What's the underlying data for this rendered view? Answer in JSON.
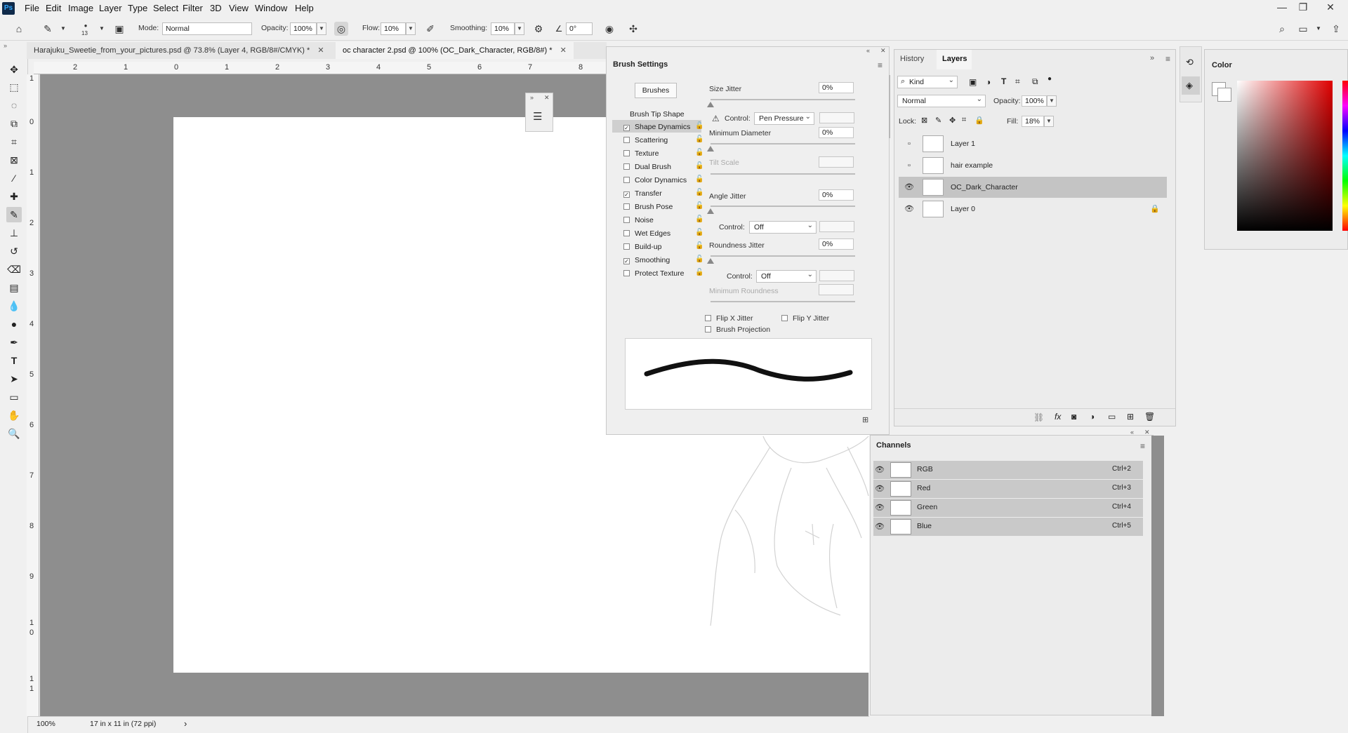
{
  "menu": {
    "logo": "Ps",
    "items": [
      "File",
      "Edit",
      "Image",
      "Layer",
      "Type",
      "Select",
      "Filter",
      "3D",
      "View",
      "Window",
      "Help"
    ]
  },
  "options": {
    "brush_size": "13",
    "mode_label": "Mode:",
    "mode_value": "Normal",
    "opacity_label": "Opacity:",
    "opacity_value": "100%",
    "flow_label": "Flow:",
    "flow_value": "10%",
    "smoothing_label": "Smoothing:",
    "smoothing_value": "10%",
    "angle_value": "0°"
  },
  "tabs": [
    {
      "label": "Harajuku_Sweetie_from_your_pictures.psd @ 73.8% (Layer 4, RGB/8#/CMYK) *"
    },
    {
      "label": "oc character 2.psd @ 100% (OC_Dark_Character, RGB/8#) *"
    }
  ],
  "ruler": {
    "top": [
      "2",
      "1",
      "0",
      "1",
      "2",
      "3",
      "4",
      "5",
      "6",
      "7",
      "8"
    ],
    "left": [
      "1",
      "0",
      "1",
      "2",
      "3",
      "4",
      "5",
      "6",
      "7",
      "8",
      "9",
      "1",
      "0",
      "1",
      "1"
    ]
  },
  "status": {
    "zoom": "100%",
    "doc_size": "17 in x 11 in (72 ppi)",
    "arrow": "›"
  },
  "brush_settings": {
    "title": "Brush Settings",
    "brushes_button": "Brushes",
    "tip_shape": "Brush Tip Shape",
    "items": [
      {
        "label": "Shape Dynamics",
        "checked": true
      },
      {
        "label": "Scattering",
        "checked": false
      },
      {
        "label": "Texture",
        "checked": false
      },
      {
        "label": "Dual Brush",
        "checked": false
      },
      {
        "label": "Color Dynamics",
        "checked": false
      },
      {
        "label": "Transfer",
        "checked": true
      },
      {
        "label": "Brush Pose",
        "checked": false
      },
      {
        "label": "Noise",
        "checked": false
      },
      {
        "label": "Wet Edges",
        "checked": false
      },
      {
        "label": "Build-up",
        "checked": false
      },
      {
        "label": "Smoothing",
        "checked": true
      },
      {
        "label": "Protect Texture",
        "checked": false
      }
    ],
    "size_jitter": "Size Jitter",
    "size_jitter_value": "0%",
    "control": "Control:",
    "pen_pressure": "Pen Pressure",
    "min_diameter": "Minimum Diameter",
    "min_diameter_value": "0%",
    "tilt_scale": "Tilt Scale",
    "angle_jitter": "Angle Jitter",
    "angle_jitter_value": "0%",
    "off1": "Off",
    "roundness_jitter": "Roundness Jitter",
    "roundness_jitter_value": "0%",
    "off2": "Off",
    "min_roundness": "Minimum Roundness",
    "flip_x": "Flip X Jitter",
    "flip_y": "Flip Y Jitter",
    "projection": "Brush Projection"
  },
  "layers": {
    "tab_history": "History",
    "tab_layers": "Layers",
    "kind": "Kind",
    "blend": "Normal",
    "opacity_label": "Opacity:",
    "opacity_value": "100%",
    "lock_label": "Lock:",
    "fill_label": "Fill:",
    "fill_value": "18%",
    "rows": [
      {
        "name": "Layer 1",
        "visible": false
      },
      {
        "name": "hair example",
        "visible": false
      },
      {
        "name": "OC_Dark_Character",
        "visible": true
      },
      {
        "name": "Layer 0",
        "visible": true
      }
    ]
  },
  "channels": {
    "title": "Channels",
    "rows": [
      {
        "name": "RGB",
        "shortcut": "Ctrl+2"
      },
      {
        "name": "Red",
        "shortcut": "Ctrl+3"
      },
      {
        "name": "Green",
        "shortcut": "Ctrl+4"
      },
      {
        "name": "Blue",
        "shortcut": "Ctrl+5"
      }
    ]
  },
  "color": {
    "title": "Color"
  }
}
